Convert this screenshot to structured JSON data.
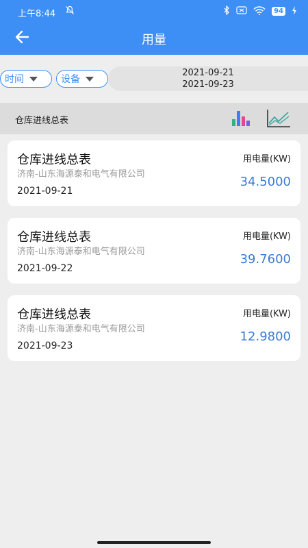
{
  "status_bar": {
    "time": "上午8:44",
    "battery": "94"
  },
  "header": {
    "title": "用量"
  },
  "filters": {
    "time_label": "时间",
    "device_label": "设备",
    "date_start": "2021-09-21",
    "date_end": "2021-09-23"
  },
  "section": {
    "title": "仓库进线总表"
  },
  "records": [
    {
      "name": "仓库进线总表",
      "company": "济南-山东海源泰和电气有限公司",
      "date": "2021-09-21",
      "unit_label": "用电量(KW)",
      "value": "34.5000"
    },
    {
      "name": "仓库进线总表",
      "company": "济南-山东海源泰和电气有限公司",
      "date": "2021-09-22",
      "unit_label": "用电量(KW)",
      "value": "39.7600"
    },
    {
      "name": "仓库进线总表",
      "company": "济南-山东海源泰和电气有限公司",
      "date": "2021-09-23",
      "unit_label": "用电量(KW)",
      "value": "12.9800"
    }
  ],
  "colors": {
    "accent": "#3d8ef5",
    "value_text": "#3a7bd5"
  }
}
